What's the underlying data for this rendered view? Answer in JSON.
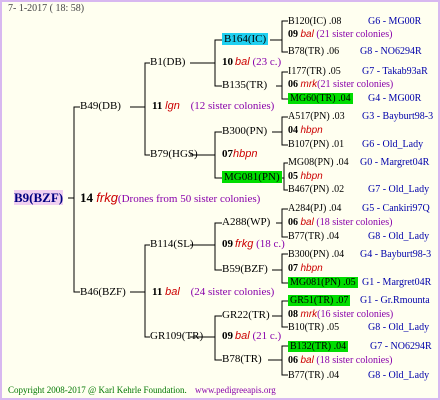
{
  "header": {
    "date": "7-  1-2017 ( 18: 58)"
  },
  "footer": {
    "copyright": "Copyright 2008-2017 @ Karl Kehrle Foundation.",
    "site": "www.pedigreeapis.org"
  },
  "root": {
    "id": "B9(BZF)",
    "num": "14",
    "name": "frkg",
    "note": "(Drones from 50 sister colonies)"
  },
  "gen1": [
    {
      "id": "B49(DB)",
      "num": "11",
      "name": "lgn",
      "note": "(12 sister colonies)"
    },
    {
      "id": "B46(BZF)",
      "num": "11",
      "name": "bal",
      "note": "(24 sister colonies)"
    }
  ],
  "gen2": [
    {
      "id": "B1(DB)",
      "num": "10",
      "name": "bal",
      "note": "(23 c.)"
    },
    {
      "id": "B79(HGS)",
      "num": "07",
      "name": "hbpn",
      "note": ""
    },
    {
      "id": "B114(SL)",
      "num": "09",
      "name": "frkg",
      "note": "(18 c.)"
    },
    {
      "id": "GR109(TR)",
      "num": "09",
      "name": "bal",
      "note": "(21 c.)"
    }
  ],
  "gen3": [
    {
      "id": "B164(IC)"
    },
    {
      "id": "B135(TR)"
    },
    {
      "id": "B300(PN)",
      "num": "04",
      "name": "hbpn"
    },
    {
      "id": "MG081(PN)",
      "num": "05",
      "name": "hbpn"
    },
    {
      "id": "A288(WP)",
      "num": "06",
      "name": "bal"
    },
    {
      "id": "B59(BZF)",
      "num": "07",
      "name": "hbpn"
    },
    {
      "id": "GR22(TR)",
      "num": "08",
      "name": "mrk"
    },
    {
      "id": "B78(TR)",
      "num": "06",
      "name": "bal"
    }
  ],
  "gen4": [
    {
      "id": "B120(IC)",
      "val": ".08",
      "src": "G6 - MG00R"
    },
    {
      "num": "09",
      "name": "bal",
      "note": "(21 sister colonies)"
    },
    {
      "id": "B78(TR)",
      "val": ".06",
      "src": "G8 - NO6294R"
    },
    {
      "id": "I177(TR)",
      "val": ".05",
      "src": "G7 - Takab93aR"
    },
    {
      "num": "06",
      "name": "mrk",
      "note": "(21 sister colonies)"
    },
    {
      "id": "MG60(TR)",
      "val": ".04",
      "src": "G4 - MG00R"
    },
    {
      "id": "A517(PN)",
      "val": ".03",
      "src": "G3 - Bayburt98-3"
    },
    {
      "num": "04",
      "name": "hbpn"
    },
    {
      "id": "B107(PN)",
      "val": ".01",
      "src": "G6 - Old_Lady"
    },
    {
      "id": "MG08(PN)",
      "val": ".04",
      "src": "G0 - Margret04R"
    },
    {
      "num": "05",
      "name": "hbpn"
    },
    {
      "id": "B467(PN)",
      "val": ".02",
      "src": "G7 - Old_Lady"
    },
    {
      "id": "A284(PJ)",
      "val": ".04",
      "src": "G5 - Cankiri97Q"
    },
    {
      "num": "06",
      "name": "bal",
      "note": "(18 sister colonies)"
    },
    {
      "id": "B77(TR)",
      "val": ".04",
      "src": "G8 - Old_Lady"
    },
    {
      "id": "B300(PN)",
      "val": ".04",
      "src": "G4 - Bayburt98-3"
    },
    {
      "num": "07",
      "name": "hbpn"
    },
    {
      "id": "MG081(PN)",
      "val": ".05",
      "src": "G1 - Margret04R"
    },
    {
      "id": "GR51(TR)",
      "val": ".07",
      "src": "G1 - Gr.Rmounta"
    },
    {
      "num": "08",
      "name": "mrk",
      "note": "(16 sister colonies)"
    },
    {
      "id": "B10(TR)",
      "val": ".05",
      "src": "G8 - Old_Lady"
    },
    {
      "id": "B132(TR)",
      "val": ".04",
      "src": "G7 - NO6294R"
    },
    {
      "num": "06",
      "name": "bal",
      "note": "(18 sister colonies)"
    },
    {
      "id": "B77(TR)",
      "val": ".04",
      "src": "G8 - Old_Lady"
    }
  ]
}
